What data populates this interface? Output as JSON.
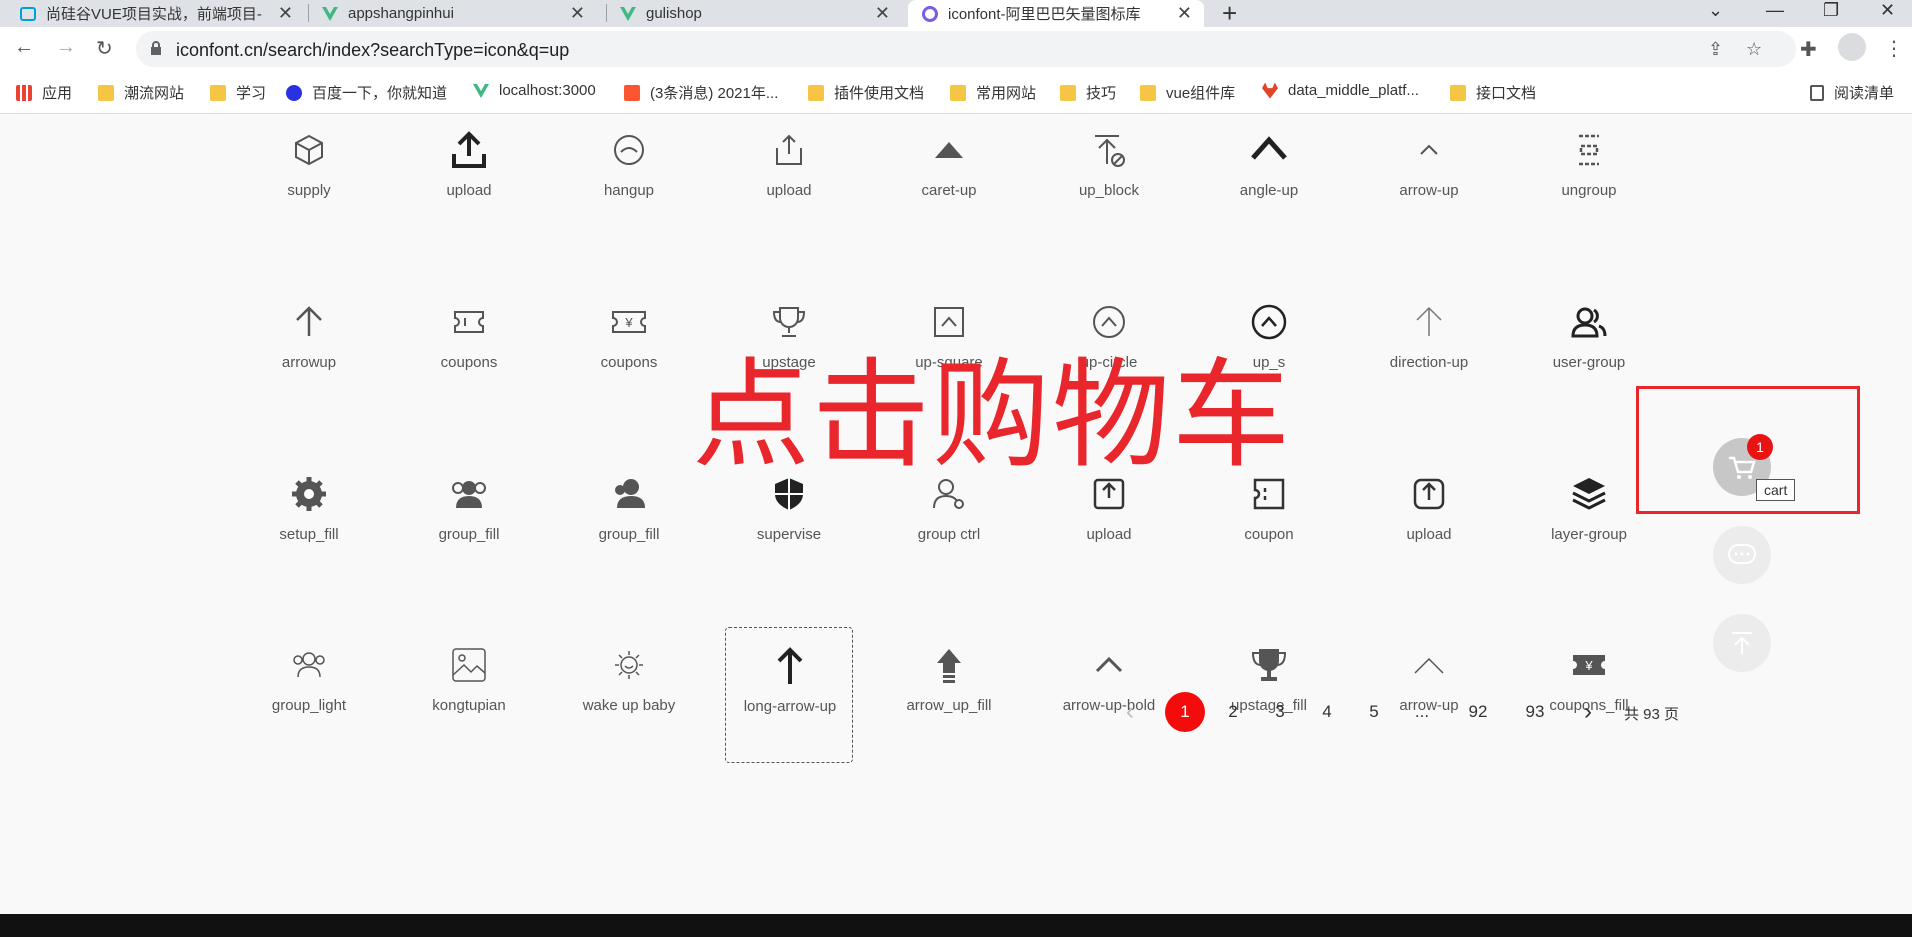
{
  "browser": {
    "tabs": [
      {
        "title": "尚硅谷VUE项目实战，前端项目-",
        "active": false
      },
      {
        "title": "appshangpinhui",
        "active": false
      },
      {
        "title": "gulishop",
        "active": false
      },
      {
        "title": "iconfont-阿里巴巴矢量图标库",
        "active": true
      }
    ],
    "url": "iconfont.cn/search/index?searchType=icon&q=up",
    "bookmarks": [
      "应用",
      "潮流网站",
      "学习",
      "百度一下，你就知道",
      "localhost:3000",
      "(3条消息) 2021年...",
      "插件使用文档",
      "常用网站",
      "技巧",
      "vue组件库",
      "data_middle_platf...",
      "接口文档"
    ],
    "reading_list": "阅读清单"
  },
  "icons": {
    "row1": [
      "supply",
      "upload",
      "hangup",
      "upload",
      "caret-up",
      "up_block",
      "angle-up",
      "arrow-up",
      "ungroup"
    ],
    "row2": [
      "arrowup",
      "coupons",
      "coupons",
      "upstage",
      "up-square",
      "up-circle",
      "up_s",
      "direction-up",
      "user-group"
    ],
    "row3": [
      "setup_fill",
      "group_fill",
      "group_fill",
      "supervise",
      "group ctrl",
      "upload",
      "coupon",
      "upload",
      "layer-group"
    ],
    "row4": [
      "group_light",
      "kongtupian",
      "wake up baby",
      "long-arrow-up",
      "arrow_up_fill",
      "arrow-up-bold",
      "upstage_fill",
      "arrow-up",
      "coupons_fill"
    ]
  },
  "overlay_text": "点击购物车",
  "cart": {
    "badge": "1",
    "tooltip": "cart"
  },
  "pagination": {
    "pages": [
      "1",
      "2",
      "3",
      "4",
      "5",
      "...",
      "92",
      "93"
    ],
    "current": "1",
    "total": "共 93 页"
  },
  "colors": {
    "accent": "#f40c0c",
    "overlay": "#e8262b"
  }
}
